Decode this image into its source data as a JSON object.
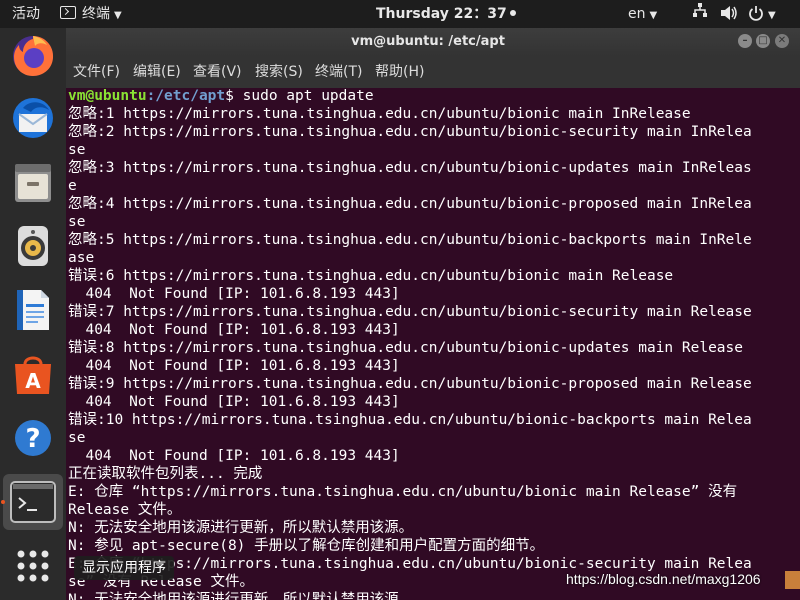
{
  "topbar": {
    "activities": "活动",
    "app_menu": "终端",
    "clock": "Thursday 22：37",
    "language": "en"
  },
  "dock": {
    "tooltip": "显示应用程序",
    "items": [
      "firefox-icon",
      "thunderbird-icon",
      "files-icon",
      "rhythmbox-icon",
      "writer-icon",
      "software-icon",
      "help-icon",
      "terminal-icon",
      "show-apps-icon"
    ]
  },
  "window": {
    "title": "vm@ubuntu: /etc/apt",
    "menu": [
      "文件(F)",
      "编辑(E)",
      "查看(V)",
      "搜索(S)",
      "终端(T)",
      "帮助(H)"
    ]
  },
  "terminal": {
    "prompt_user": "vm@ubuntu",
    "prompt_path": ":/etc/apt",
    "prompt_symbol": "$ ",
    "command": "sudo apt update",
    "lines": [
      "忽略:1 https://mirrors.tuna.tsinghua.edu.cn/ubuntu/bionic main InRelease",
      "忽略:2 https://mirrors.tuna.tsinghua.edu.cn/ubuntu/bionic-security main InRelea",
      "se",
      "忽略:3 https://mirrors.tuna.tsinghua.edu.cn/ubuntu/bionic-updates main InReleas",
      "e",
      "忽略:4 https://mirrors.tuna.tsinghua.edu.cn/ubuntu/bionic-proposed main InRelea",
      "se",
      "忽略:5 https://mirrors.tuna.tsinghua.edu.cn/ubuntu/bionic-backports main InRele",
      "ase",
      "错误:6 https://mirrors.tuna.tsinghua.edu.cn/ubuntu/bionic main Release",
      "  404  Not Found [IP: 101.6.8.193 443]",
      "错误:7 https://mirrors.tuna.tsinghua.edu.cn/ubuntu/bionic-security main Release",
      "  404  Not Found [IP: 101.6.8.193 443]",
      "错误:8 https://mirrors.tuna.tsinghua.edu.cn/ubuntu/bionic-updates main Release",
      "  404  Not Found [IP: 101.6.8.193 443]",
      "错误:9 https://mirrors.tuna.tsinghua.edu.cn/ubuntu/bionic-proposed main Release",
      "  404  Not Found [IP: 101.6.8.193 443]",
      "错误:10 https://mirrors.tuna.tsinghua.edu.cn/ubuntu/bionic-backports main Relea",
      "se",
      "  404  Not Found [IP: 101.6.8.193 443]",
      "正在读取软件包列表... 完成",
      "E: 仓库 “https://mirrors.tuna.tsinghua.edu.cn/ubuntu/bionic main Release” 没有",
      "Release 文件。",
      "N: 无法安全地用该源进行更新，所以默认禁用该源。",
      "N: 参见 apt-secure(8) 手册以了解仓库创建和用户配置方面的细节。",
      "E: 仓库 “https://mirrors.tuna.tsinghua.edu.cn/ubuntu/bionic-security main Relea",
      "se” 没有 Release 文件。",
      "N: 无法安全地用该源进行更新，所以默认禁用该源。"
    ]
  },
  "watermark": "https://blog.csdn.net/maxg1206",
  "colors": {
    "terminal_bg": "#300a24",
    "prompt_user": "#8ae234",
    "prompt_path": "#729fcf",
    "accent": "#e95420"
  }
}
